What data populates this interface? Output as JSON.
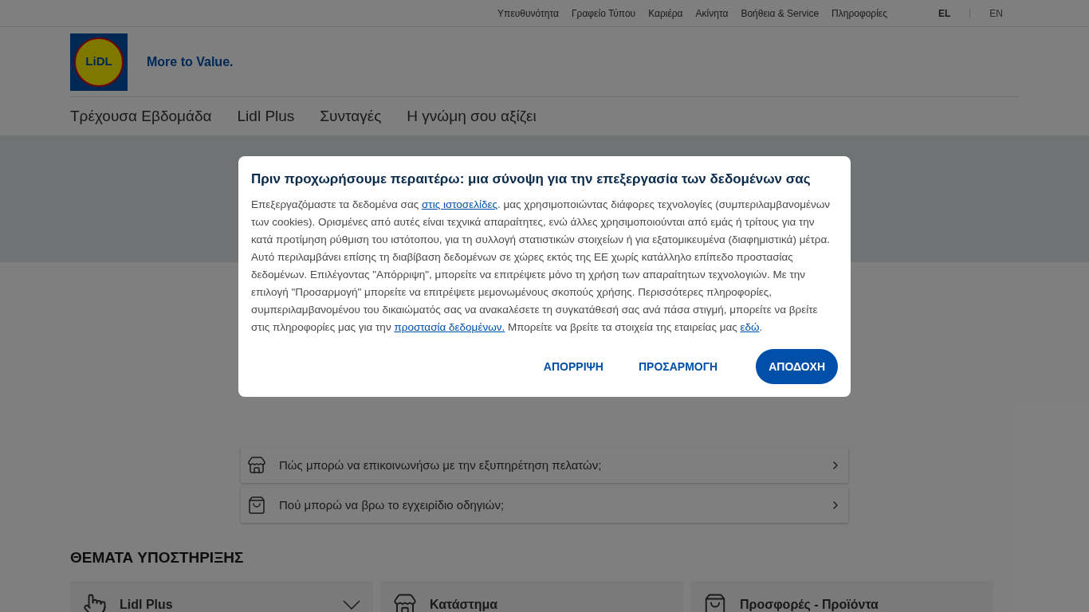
{
  "top_links": [
    "Υπευθυνότητα",
    "Γραφείο Τύπου",
    "Καριέρα",
    "Ακίνητα",
    "Βοήθεια & Service",
    "Πληροφορίες"
  ],
  "languages": [
    {
      "label": "EL",
      "selected": true
    },
    {
      "label": "EN",
      "selected": false
    }
  ],
  "logo": {
    "text": "LiDL",
    "slogan": "More to Value."
  },
  "nav": [
    "Τρέχουσα Εβδομάδα",
    "Lidl Plus",
    "Συνταγές",
    "Η γνώμη σου αξίζει"
  ],
  "faq": [
    {
      "kind": "store",
      "question": "Πώς μπορώ να επικοινωνήσω με την εξυπηρέτηση πελατών;"
    },
    {
      "kind": "bag",
      "question": "Πού μπορώ να βρω το εγχειρίδιο οδηγιών;"
    }
  ],
  "support_title": "ΘΕΜΑΤΑ ΥΠΟΣΤΗΡΙΞΗΣ",
  "topics": [
    {
      "kind": "phone",
      "label": "Lidl Plus",
      "expanded": false
    },
    {
      "kind": "store",
      "label": "Κατάστημα"
    },
    {
      "kind": "bag",
      "label": "Προσφορές - Προϊόντα"
    }
  ],
  "dialog": {
    "title": "Πριν προχωρήσουμε περαιτέρω: μια σύνοψη για την επεξεργασία των δεδομένων σας",
    "body": [
      {
        "kind": "text",
        "text": "Επεξεργαζόμαστε τα δεδομένα σας "
      },
      {
        "kind": "link",
        "text": "στις ιστοσελίδες"
      },
      {
        "kind": "text",
        "text": ". μας χρησιμοποιώντας διάφορες τεχνολογίες (συμπεριλαμβανομένων των cookies). Ορισμένες από αυτές είναι τεχνικά απαραίτητες, ενώ άλλες χρησιμοποιούνται από εμάς ή τρίτους για την κατά προτίμηση ρύθμιση του ιστότοπου, για τη συλλογή στατιστικών στοιχείων ή για εξατομικευμένα (διαφημιστικά) μέτρα. Αυτό περιλαμβάνει επίσης τη διαβίβαση δεδομένων σε χώρες εκτός της ΕΕ χωρίς κατάλληλο επίπεδο προστασίας δεδομένων. Επιλέγοντας \"Απόρριψη\", μπορείτε να επιτρέψετε μόνο τη χρήση των απαραίτητων τεχνολογιών. Με την επιλογή \"Προσαρμογή\" μπορείτε να επιτρέψετε μεμονωμένους σκοπούς χρήσης. Περισσότερες πληροφορίες, συμπεριλαμβανομένου του δικαιώματός σας να ανακαλέσετε τη συγκατάθεσή σας ανά πάσα στιγμή, μπορείτε να βρείτε στις πληροφορίες μας για την "
      },
      {
        "kind": "link",
        "text": "προστασία δεδομένων."
      },
      {
        "kind": "text",
        "text": " Μπορείτε να βρείτε τα στοιχεία της εταιρείας μας "
      },
      {
        "kind": "link",
        "text": "εδώ"
      },
      {
        "kind": "text",
        "text": "."
      }
    ],
    "buttons": [
      {
        "kind": "text",
        "label": "ΑΠΟΡΡΙΨΗ"
      },
      {
        "kind": "text",
        "label": "ΠΡΟΣΑΡΜΟΓΗ"
      },
      {
        "kind": "primary",
        "label": "ΑΠΟΔΟΧΗ"
      }
    ]
  }
}
